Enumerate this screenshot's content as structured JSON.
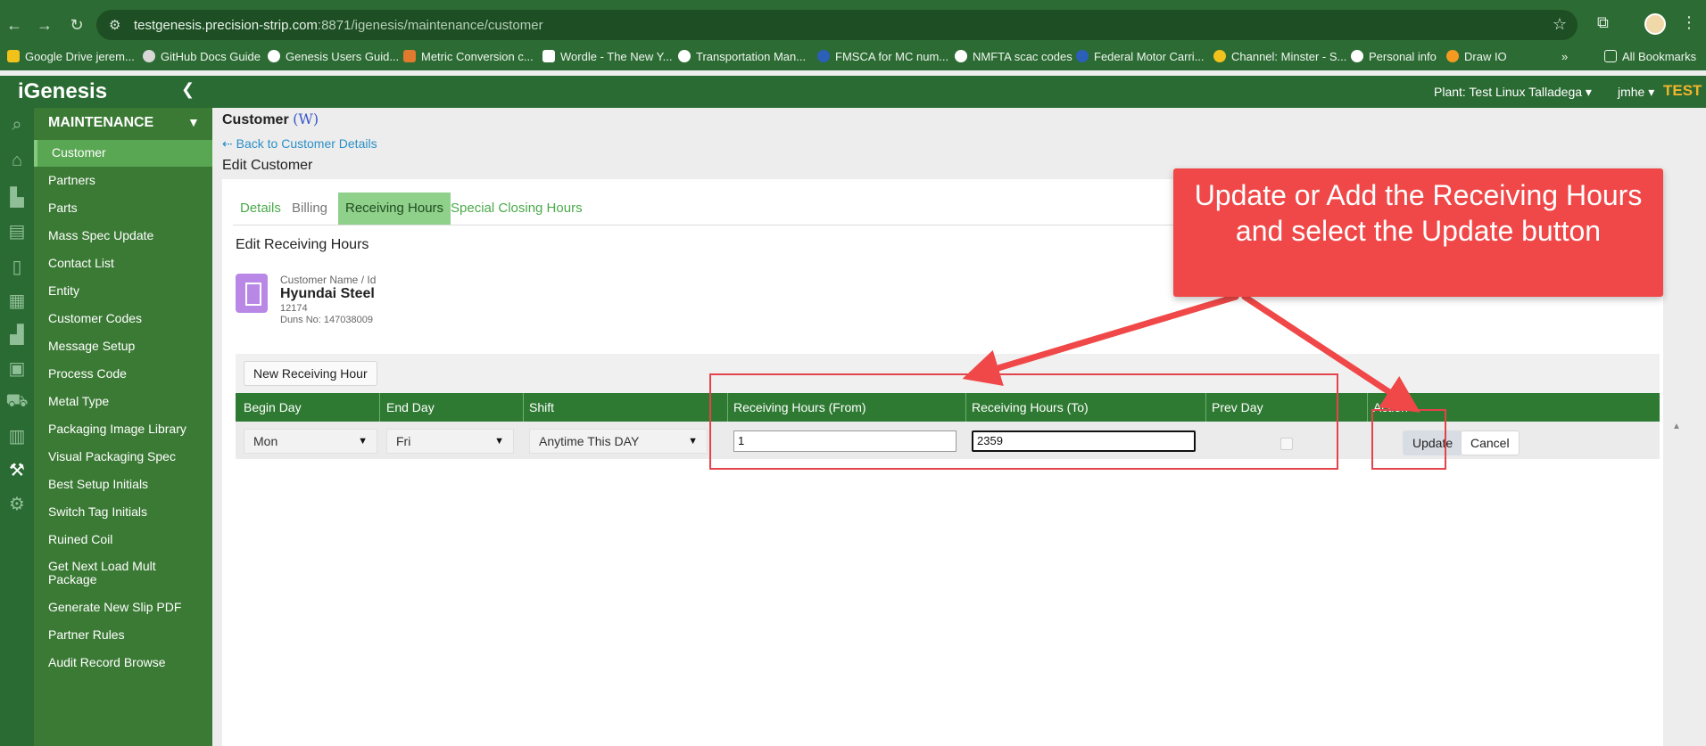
{
  "browser": {
    "url_host": "testgenesis.precision-strip.com",
    "url_path": ":8871/igenesis/maintenance/customer",
    "bookmarks": [
      "Google Drive jerem...",
      "GitHub Docs Guide",
      "Genesis Users Guid...",
      "Metric Conversion c...",
      "Wordle - The New Y...",
      "Transportation Man...",
      "FMSCA for MC num...",
      "NMFTA scac codes",
      "Federal Motor Carri...",
      "Channel: Minster - S...",
      "Personal info",
      "Draw IO"
    ],
    "more_bookmarks": "»",
    "all_bookmarks": "All Bookmarks"
  },
  "app": {
    "logo": "iGenesis",
    "plant": "Plant: Test Linux Talladega",
    "user": "jmhe",
    "env": "TEST"
  },
  "sidebar": {
    "title": "MAINTENANCE",
    "items": [
      "Customer",
      "Partners",
      "Parts",
      "Mass Spec Update",
      "Contact List",
      "Entity",
      "Customer Codes",
      "Message Setup",
      "Process Code",
      "Metal Type",
      "Packaging Image Library",
      "Visual Packaging Spec",
      "Best Setup Initials",
      "Switch Tag Initials",
      "Ruined Coil",
      "Get Next Load Mult Package",
      "Generate New Slip PDF",
      "Partner Rules",
      "Audit Record Browse"
    ],
    "active_index": 0
  },
  "page": {
    "title": "Customer",
    "title_link": "(W)",
    "back_link": "Back to Customer Details",
    "heading": "Edit Customer",
    "tabs": [
      "Details",
      "Billing",
      "Receiving Hours",
      "Special Closing Hours"
    ],
    "active_tab": 2,
    "section_title": "Edit Receiving Hours"
  },
  "customer": {
    "label": "Customer Name / Id",
    "name": "Hyundai Steel",
    "id": "12174",
    "duns": "Duns No: 147038009"
  },
  "grid": {
    "new_button": "New Receiving Hour",
    "columns": [
      "Begin Day",
      "End Day",
      "Shift",
      "Receiving Hours (From)",
      "Receiving Hours (To)",
      "Prev Day",
      "Action"
    ],
    "row": {
      "begin_day": "Mon",
      "end_day": "Fri",
      "shift": "Anytime This DAY",
      "from": "1",
      "to": "2359",
      "prev_day": false,
      "update_label": "Update",
      "cancel_label": "Cancel"
    }
  },
  "annotation": {
    "text": "Update or Add the Receiving Hours and select the Update button",
    "color": "#f04848"
  },
  "colors": {
    "brand_green": "#2a6a33",
    "sidebar_green": "#3b7a35",
    "active_green": "#5aa753",
    "accent_gold": "#f2b42c"
  }
}
